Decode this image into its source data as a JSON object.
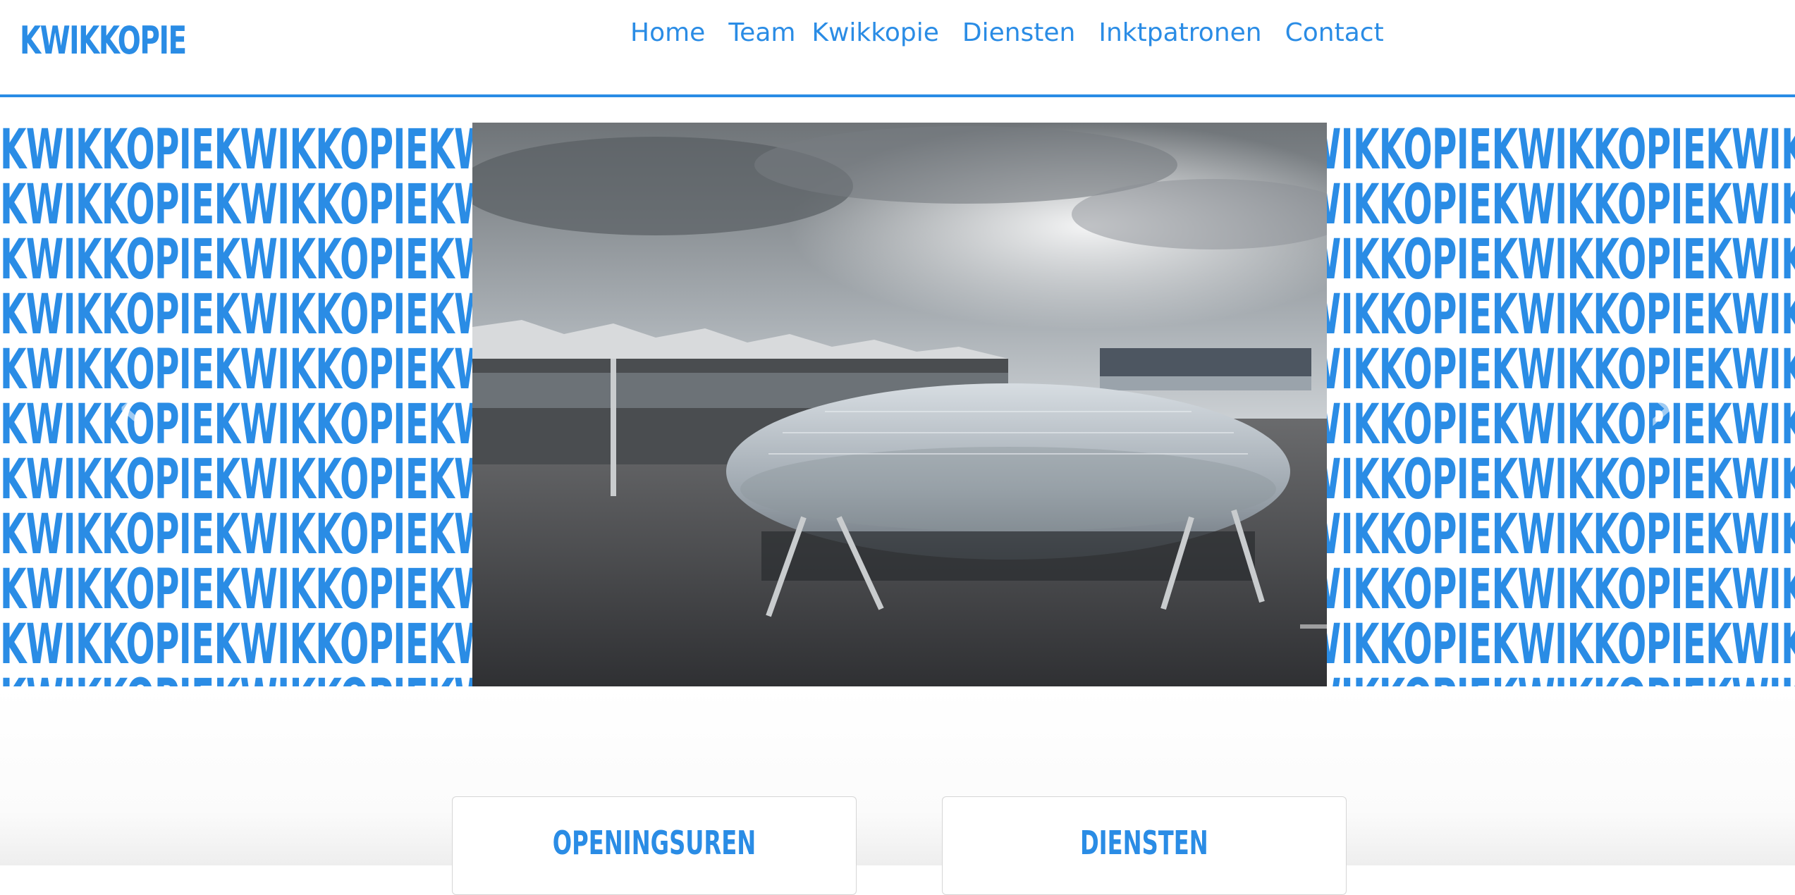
{
  "header": {
    "logo": "KWIKKOPIE",
    "nav": [
      "Home",
      "Team  Kwikkopie",
      "Diensten",
      "Inktpatronen",
      "Contact"
    ]
  },
  "banner": {
    "pattern_text": "KWIKKOPIEKWIKKOPIEKWIKKOPIEKWIKKOPIE",
    "prev_glyph": "‹",
    "next_glyph": "›",
    "slides": 3,
    "active_slide": 3
  },
  "cards": {
    "openingsuren": "OPENINGSUREN",
    "diensten": "DIENSTEN"
  },
  "colors": {
    "brand": "#2a8ce5",
    "background": "#ffffff"
  }
}
